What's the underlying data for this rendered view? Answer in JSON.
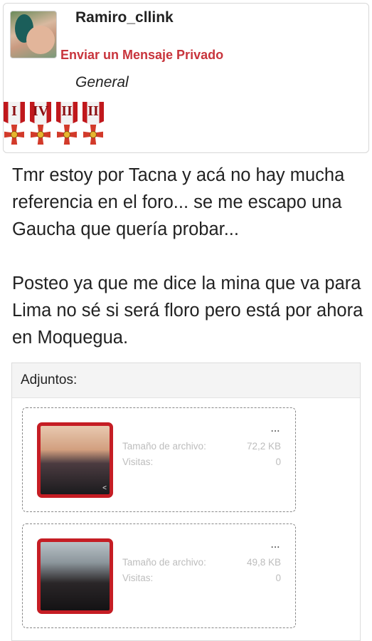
{
  "user": {
    "username": "Ramiro_cllink",
    "private_message_link": "Enviar un Mensaje Privado",
    "rank": "General",
    "medals": [
      {
        "numeral": "I"
      },
      {
        "numeral": "IV"
      },
      {
        "numeral": "II"
      },
      {
        "numeral": "II"
      }
    ]
  },
  "post": {
    "paragraphs": [
      "Tmr estoy por Tacna y acá no hay mucha referencia en el foro... se me escapo una Gaucha que quería probar...",
      "Posteo ya que me dice la mina que va para Lima no sé si será floro pero está por ahora en Moquegua."
    ]
  },
  "attachments": {
    "title": "Adjuntos:",
    "items": [
      {
        "name": "...",
        "size_label": "Tamaño de archivo:",
        "size": "72,2 KB",
        "views_label": "Visitas:",
        "views": "0"
      },
      {
        "name": "...",
        "size_label": "Tamaño de archivo:",
        "size": "49,8 KB",
        "views_label": "Visitas:",
        "views": "0"
      }
    ]
  },
  "colors": {
    "link_red": "#c8343c",
    "thumb_border": "#c51d24",
    "text": "#222222",
    "muted": "#bdbdbd"
  }
}
